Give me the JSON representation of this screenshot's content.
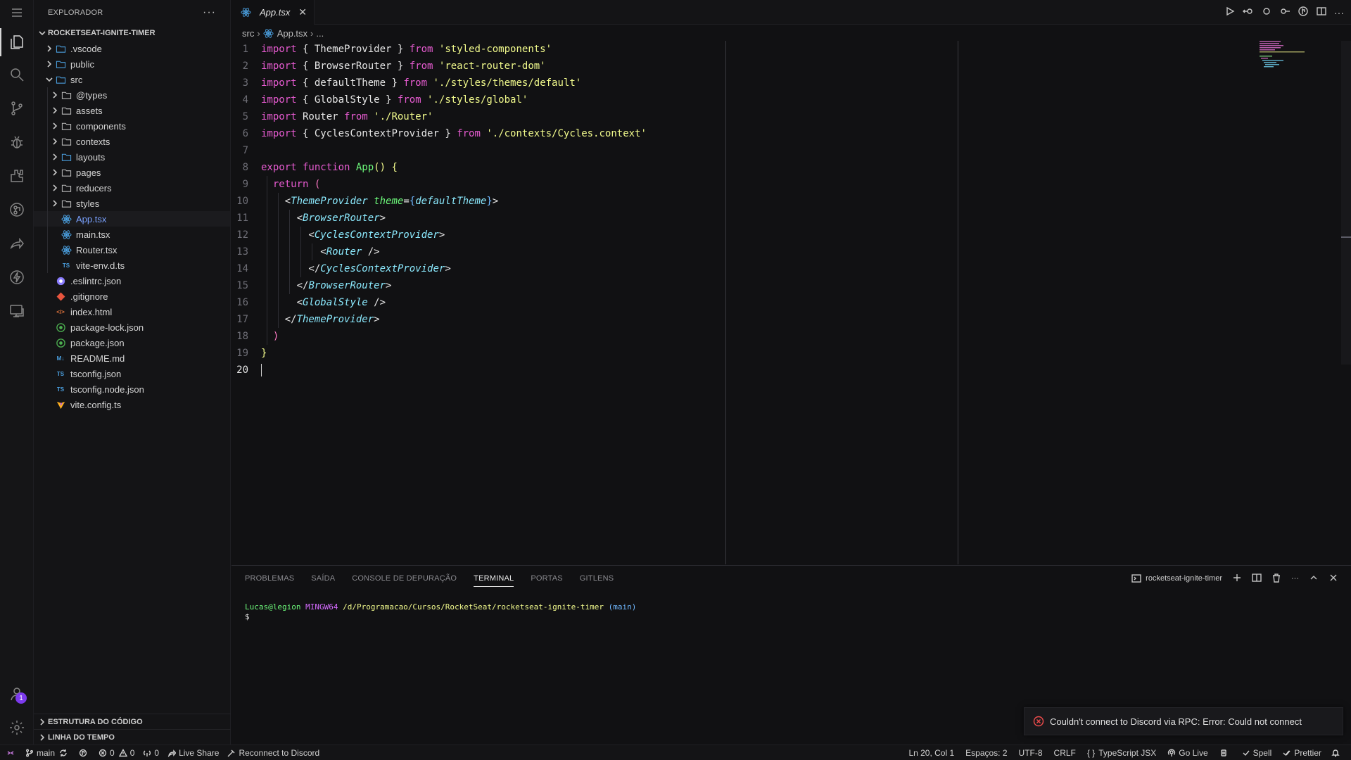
{
  "sidebar": {
    "title": "EXPLORADOR",
    "more_label": "···",
    "project": "ROCKETSEAT-IGNITE-TIMER",
    "tree": [
      {
        "label": ".vscode",
        "kind": "folder",
        "depth": 1,
        "expanded": false,
        "icon": "folder-vscode-icon",
        "color": "#4ba0e0"
      },
      {
        "label": "public",
        "kind": "folder",
        "depth": 1,
        "expanded": false,
        "icon": "folder-public-icon",
        "color": "#4ba0e0"
      },
      {
        "label": "src",
        "kind": "folder",
        "depth": 1,
        "expanded": true,
        "icon": "folder-src-icon",
        "color": "#4ba0e0"
      },
      {
        "label": "@types",
        "kind": "folder",
        "depth": 2,
        "expanded": false,
        "icon": "folder-icon",
        "color": "#bbbbbb"
      },
      {
        "label": "assets",
        "kind": "folder",
        "depth": 2,
        "expanded": false,
        "icon": "folder-icon",
        "color": "#bbbbbb"
      },
      {
        "label": "components",
        "kind": "folder",
        "depth": 2,
        "expanded": false,
        "icon": "folder-components-icon",
        "color": "#bbbbbb"
      },
      {
        "label": "contexts",
        "kind": "folder",
        "depth": 2,
        "expanded": false,
        "icon": "folder-icon",
        "color": "#bbbbbb"
      },
      {
        "label": "layouts",
        "kind": "folder",
        "depth": 2,
        "expanded": false,
        "icon": "folder-layout-icon",
        "color": "#4ba0e0"
      },
      {
        "label": "pages",
        "kind": "folder",
        "depth": 2,
        "expanded": false,
        "icon": "folder-icon",
        "color": "#bbbbbb"
      },
      {
        "label": "reducers",
        "kind": "folder",
        "depth": 2,
        "expanded": false,
        "icon": "folder-icon",
        "color": "#bbbbbb"
      },
      {
        "label": "styles",
        "kind": "folder",
        "depth": 2,
        "expanded": false,
        "icon": "folder-icon",
        "color": "#bbbbbb"
      },
      {
        "label": "App.tsx",
        "kind": "file",
        "depth": 2,
        "icon": "react-icon",
        "color": "#4ba0e0",
        "selected": true
      },
      {
        "label": "main.tsx",
        "kind": "file",
        "depth": 2,
        "icon": "react-icon",
        "color": "#4ba0e0"
      },
      {
        "label": "Router.tsx",
        "kind": "file",
        "depth": 2,
        "icon": "react-icon",
        "color": "#4ba0e0"
      },
      {
        "label": "vite-env.d.ts",
        "kind": "file",
        "depth": 2,
        "icon": "typescript-def-icon",
        "color": "#4ba0e0",
        "glyph": "TS"
      },
      {
        "label": ".eslintrc.json",
        "kind": "file",
        "depth": 1,
        "icon": "eslint-icon",
        "color": "#8b7dff"
      },
      {
        "label": ".gitignore",
        "kind": "file",
        "depth": 1,
        "icon": "git-icon",
        "color": "#e8553e"
      },
      {
        "label": "index.html",
        "kind": "file",
        "depth": 1,
        "icon": "html-icon",
        "color": "#e8773e",
        "glyph": "</>"
      },
      {
        "label": "package-lock.json",
        "kind": "file",
        "depth": 1,
        "icon": "npm-icon",
        "color": "#4caf50"
      },
      {
        "label": "package.json",
        "kind": "file",
        "depth": 1,
        "icon": "npm-icon",
        "color": "#4caf50"
      },
      {
        "label": "README.md",
        "kind": "file",
        "depth": 1,
        "icon": "markdown-icon",
        "color": "#4ba0e0",
        "glyph": "M↓"
      },
      {
        "label": "tsconfig.json",
        "kind": "file",
        "depth": 1,
        "icon": "tsconfig-icon",
        "color": "#4ba0e0",
        "glyph": "TS"
      },
      {
        "label": "tsconfig.node.json",
        "kind": "file",
        "depth": 1,
        "icon": "tsconfig-icon",
        "color": "#4ba0e0",
        "glyph": "TS"
      },
      {
        "label": "vite.config.ts",
        "kind": "file",
        "depth": 1,
        "icon": "vite-icon",
        "color": "#ffb020"
      }
    ],
    "footer_outline": "ESTRUTURA DO CÓDIGO",
    "footer_timeline": "LINHA DO TEMPO"
  },
  "activity_badge": "1",
  "tab": {
    "label": "App.tsx",
    "close": "✕"
  },
  "breadcrumb": {
    "folder": "src",
    "file": "App.tsx",
    "more": "..."
  },
  "code": {
    "current_line": 20,
    "lines": [
      [
        [
          "kw",
          "import"
        ],
        [
          "pun",
          " { "
        ],
        [
          "id",
          "ThemeProvider"
        ],
        [
          "pun",
          " } "
        ],
        [
          "kw",
          "from"
        ],
        [
          "str",
          " 'styled-components'"
        ]
      ],
      [
        [
          "kw",
          "import"
        ],
        [
          "pun",
          " { "
        ],
        [
          "id",
          "BrowserRouter"
        ],
        [
          "pun",
          " } "
        ],
        [
          "kw",
          "from"
        ],
        [
          "str",
          " 'react-router-dom'"
        ]
      ],
      [
        [
          "kw",
          "import"
        ],
        [
          "pun",
          " { "
        ],
        [
          "id",
          "defaultTheme"
        ],
        [
          "pun",
          " } "
        ],
        [
          "kw",
          "from"
        ],
        [
          "str",
          " './styles/themes/default'"
        ]
      ],
      [
        [
          "kw",
          "import"
        ],
        [
          "pun",
          " { "
        ],
        [
          "id",
          "GlobalStyle"
        ],
        [
          "pun",
          " } "
        ],
        [
          "kw",
          "from"
        ],
        [
          "str",
          " './styles/global'"
        ]
      ],
      [
        [
          "kw",
          "import"
        ],
        [
          "id",
          " Router "
        ],
        [
          "kw",
          "from"
        ],
        [
          "str",
          " './Router'"
        ]
      ],
      [
        [
          "kw",
          "import"
        ],
        [
          "pun",
          " { "
        ],
        [
          "id",
          "CyclesContextProvider"
        ],
        [
          "pun",
          " } "
        ],
        [
          "kw",
          "from"
        ],
        [
          "str",
          " './contexts/Cycles.context'"
        ]
      ],
      [],
      [
        [
          "kw",
          "export"
        ],
        [
          "kw",
          " function"
        ],
        [
          "fn",
          " App"
        ],
        [
          "br1",
          "()"
        ],
        [
          "pun",
          " "
        ],
        [
          "br1",
          "{"
        ]
      ],
      [
        [
          "pun",
          "  "
        ],
        [
          "kw",
          "return"
        ],
        [
          "pun",
          " "
        ],
        [
          "br2",
          "("
        ]
      ],
      [
        [
          "pun",
          "    <"
        ],
        [
          "tag",
          "ThemeProvider"
        ],
        [
          "pun",
          " "
        ],
        [
          "attr",
          "theme"
        ],
        [
          "pun",
          "="
        ],
        [
          "br3",
          "{"
        ],
        [
          "tag",
          "defaultTheme"
        ],
        [
          "br3",
          "}"
        ],
        [
          "pun",
          ">"
        ]
      ],
      [
        [
          "pun",
          "      <"
        ],
        [
          "tag",
          "BrowserRouter"
        ],
        [
          "pun",
          ">"
        ]
      ],
      [
        [
          "pun",
          "        <"
        ],
        [
          "tag",
          "CyclesContextProvider"
        ],
        [
          "pun",
          ">"
        ]
      ],
      [
        [
          "pun",
          "          <"
        ],
        [
          "tag",
          "Router"
        ],
        [
          "pun",
          " />"
        ]
      ],
      [
        [
          "pun",
          "        </"
        ],
        [
          "tag",
          "CyclesContextProvider"
        ],
        [
          "pun",
          ">"
        ]
      ],
      [
        [
          "pun",
          "      </"
        ],
        [
          "tag",
          "BrowserRouter"
        ],
        [
          "pun",
          ">"
        ]
      ],
      [
        [
          "pun",
          "      <"
        ],
        [
          "tag",
          "GlobalStyle"
        ],
        [
          "pun",
          " />"
        ]
      ],
      [
        [
          "pun",
          "    </"
        ],
        [
          "tag",
          "ThemeProvider"
        ],
        [
          "pun",
          ">"
        ]
      ],
      [
        [
          "pun",
          "  "
        ],
        [
          "br2",
          ")"
        ]
      ],
      [
        [
          "br1",
          "}"
        ]
      ],
      []
    ]
  },
  "panel": {
    "tabs": [
      "PROBLEMAS",
      "SAÍDA",
      "CONSOLE DE DEPURAÇÃO",
      "TERMINAL",
      "PORTAS",
      "GITLENS"
    ],
    "active_tab": "TERMINAL",
    "terminal_name": "rocketseat-ignite-timer",
    "terminal": {
      "user": "Lucas@legion",
      "host": "MINGW64",
      "path": "/d/Programacao/Cursos/RocketSeat/rocketseat-ignite-timer",
      "branch": "(main)",
      "prompt": "$"
    }
  },
  "toast": {
    "message": "Couldn't connect to Discord via RPC: Error: Could not connect",
    "color": "#f14c4c"
  },
  "status": {
    "branch": "main",
    "errors": "0",
    "warnings": "0",
    "ports": "0",
    "live_share": "Live Share",
    "discord": "Reconnect to Discord",
    "position": "Ln 20, Col 1",
    "spaces": "Espaços: 2",
    "encoding": "UTF-8",
    "eol": "CRLF",
    "language": "TypeScript JSX",
    "go_live": "Go Live",
    "spell": "Spell",
    "prettier": "Prettier"
  }
}
